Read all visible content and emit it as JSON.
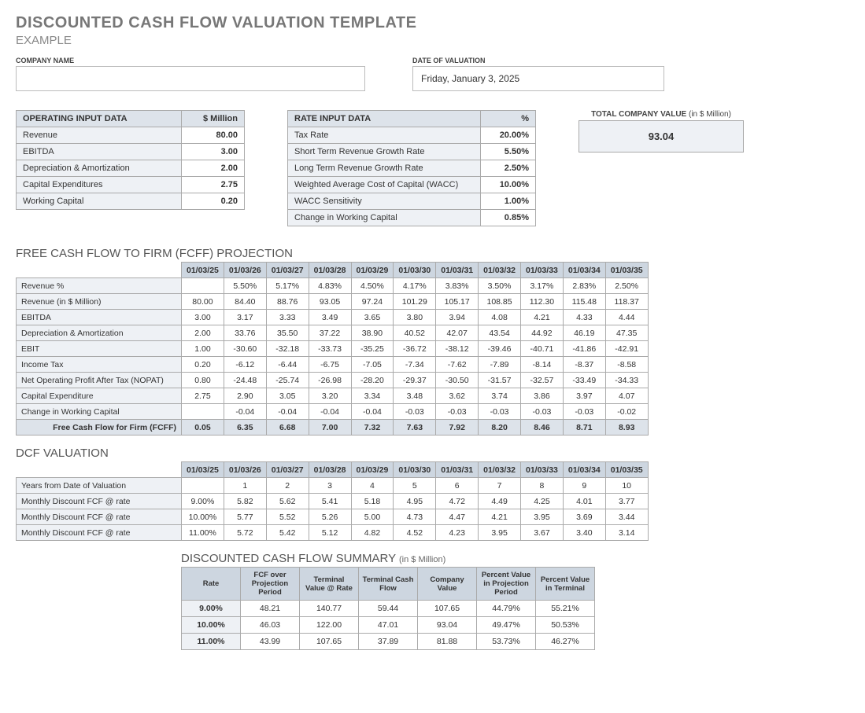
{
  "title": "DISCOUNTED CASH FLOW VALUATION TEMPLATE",
  "subtitle": "EXAMPLE",
  "company_name_label": "COMPANY NAME",
  "company_name_value": "",
  "date_label": "DATE OF VALUATION",
  "date_value": "Friday, January 3, 2025",
  "op_header_label": "OPERATING INPUT DATA",
  "op_header_unit": "$ Million",
  "op_rows": [
    {
      "label": "Revenue",
      "value": "80.00"
    },
    {
      "label": "EBITDA",
      "value": "3.00"
    },
    {
      "label": "Depreciation & Amortization",
      "value": "2.00"
    },
    {
      "label": "Capital Expenditures",
      "value": "2.75"
    },
    {
      "label": "Working Capital",
      "value": "0.20"
    }
  ],
  "rate_header_label": "RATE INPUT DATA",
  "rate_header_unit": "%",
  "rate_rows": [
    {
      "label": "Tax Rate",
      "value": "20.00%"
    },
    {
      "label": "Short Term Revenue Growth Rate",
      "value": "5.50%"
    },
    {
      "label": "Long Term Revenue Growth Rate",
      "value": "2.50%"
    },
    {
      "label": "Weighted Average Cost of Capital (WACC)",
      "value": "10.00%"
    },
    {
      "label": "WACC Sensitivity",
      "value": "1.00%"
    },
    {
      "label": "Change in Working Capital",
      "value": "0.85%"
    }
  ],
  "total_label": "TOTAL COMPANY VALUE",
  "total_unit": "(in $ Million)",
  "total_value": "93.04",
  "fcff_title": "FREE CASH FLOW TO FIRM (FCFF) PROJECTION",
  "dates": [
    "01/03/25",
    "01/03/26",
    "01/03/27",
    "01/03/28",
    "01/03/29",
    "01/03/30",
    "01/03/31",
    "01/03/32",
    "01/03/33",
    "01/03/34",
    "01/03/35"
  ],
  "fcff_rows": [
    {
      "label": "Revenue %",
      "vals": [
        "",
        "5.50%",
        "5.17%",
        "4.83%",
        "4.50%",
        "4.17%",
        "3.83%",
        "3.50%",
        "3.17%",
        "2.83%",
        "2.50%"
      ]
    },
    {
      "label": "Revenue (in $ Million)",
      "vals": [
        "80.00",
        "84.40",
        "88.76",
        "93.05",
        "97.24",
        "101.29",
        "105.17",
        "108.85",
        "112.30",
        "115.48",
        "118.37"
      ]
    },
    {
      "label": "EBITDA",
      "vals": [
        "3.00",
        "3.17",
        "3.33",
        "3.49",
        "3.65",
        "3.80",
        "3.94",
        "4.08",
        "4.21",
        "4.33",
        "4.44"
      ]
    },
    {
      "label": "Depreciation & Amortization",
      "vals": [
        "2.00",
        "33.76",
        "35.50",
        "37.22",
        "38.90",
        "40.52",
        "42.07",
        "43.54",
        "44.92",
        "46.19",
        "47.35"
      ]
    },
    {
      "label": "EBIT",
      "vals": [
        "1.00",
        "-30.60",
        "-32.18",
        "-33.73",
        "-35.25",
        "-36.72",
        "-38.12",
        "-39.46",
        "-40.71",
        "-41.86",
        "-42.91"
      ]
    },
    {
      "label": "Income Tax",
      "vals": [
        "0.20",
        "-6.12",
        "-6.44",
        "-6.75",
        "-7.05",
        "-7.34",
        "-7.62",
        "-7.89",
        "-8.14",
        "-8.37",
        "-8.58"
      ]
    },
    {
      "label": "Net Operating Profit After Tax (NOPAT)",
      "vals": [
        "0.80",
        "-24.48",
        "-25.74",
        "-26.98",
        "-28.20",
        "-29.37",
        "-30.50",
        "-31.57",
        "-32.57",
        "-33.49",
        "-34.33"
      ]
    },
    {
      "label": "Capital Expenditure",
      "vals": [
        "2.75",
        "2.90",
        "3.05",
        "3.20",
        "3.34",
        "3.48",
        "3.62",
        "3.74",
        "3.86",
        "3.97",
        "4.07"
      ]
    },
    {
      "label": "Change in Working Capital",
      "vals": [
        "",
        "-0.04",
        "-0.04",
        "-0.04",
        "-0.04",
        "-0.03",
        "-0.03",
        "-0.03",
        "-0.03",
        "-0.03",
        "-0.02"
      ]
    }
  ],
  "fcff_total_label": "Free Cash Flow for Firm (FCFF)",
  "fcff_total_vals": [
    "0.05",
    "6.35",
    "6.68",
    "7.00",
    "7.32",
    "7.63",
    "7.92",
    "8.20",
    "8.46",
    "8.71",
    "8.93"
  ],
  "dcf_title": "DCF VALUATION",
  "dcf_rows": [
    {
      "label": "Years from Date of Valuation",
      "vals": [
        "",
        "1",
        "2",
        "3",
        "4",
        "5",
        "6",
        "7",
        "8",
        "9",
        "10"
      ]
    },
    {
      "label": "Monthly Discount FCF @ rate",
      "vals": [
        "9.00%",
        "5.82",
        "5.62",
        "5.41",
        "5.18",
        "4.95",
        "4.72",
        "4.49",
        "4.25",
        "4.01",
        "3.77"
      ]
    },
    {
      "label": "Monthly Discount FCF @ rate",
      "vals": [
        "10.00%",
        "5.77",
        "5.52",
        "5.26",
        "5.00",
        "4.73",
        "4.47",
        "4.21",
        "3.95",
        "3.69",
        "3.44"
      ]
    },
    {
      "label": "Monthly Discount FCF @ rate",
      "vals": [
        "11.00%",
        "5.72",
        "5.42",
        "5.12",
        "4.82",
        "4.52",
        "4.23",
        "3.95",
        "3.67",
        "3.40",
        "3.14"
      ]
    }
  ],
  "sum_title": "DISCOUNTED CASH FLOW SUMMARY",
  "sum_unit": "(in $ Million)",
  "sum_headers": [
    "Rate",
    "FCF over Projection Period",
    "Terminal Value @ Rate",
    "Terminal Cash Flow",
    "Company Value",
    "Percent Value in Projection Period",
    "Percent Value in Terminal"
  ],
  "sum_rows": [
    {
      "rate": "9.00%",
      "vals": [
        "48.21",
        "140.77",
        "59.44",
        "107.65",
        "44.79%",
        "55.21%"
      ]
    },
    {
      "rate": "10.00%",
      "vals": [
        "46.03",
        "122.00",
        "47.01",
        "93.04",
        "49.47%",
        "50.53%"
      ]
    },
    {
      "rate": "11.00%",
      "vals": [
        "43.99",
        "107.65",
        "37.89",
        "81.88",
        "53.73%",
        "46.27%"
      ]
    }
  ]
}
